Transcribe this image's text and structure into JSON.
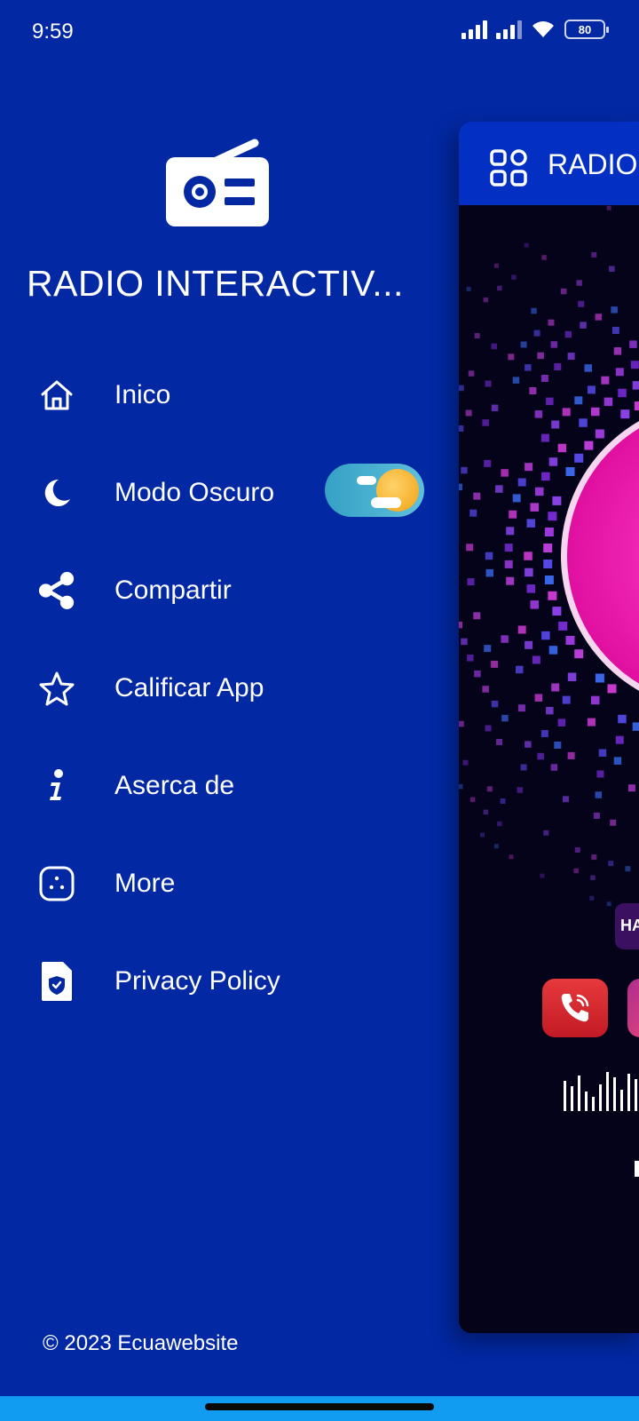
{
  "status_bar": {
    "time": "9:59",
    "battery": "80"
  },
  "drawer": {
    "title": "RADIO INTERACTIV...",
    "menu": [
      {
        "label": "Inico",
        "icon": "home-icon"
      },
      {
        "label": "Modo Oscuro",
        "icon": "moon-icon"
      },
      {
        "label": "Compartir",
        "icon": "share-icon"
      },
      {
        "label": "Calificar App",
        "icon": "star-icon"
      },
      {
        "label": "Aserca de",
        "icon": "info-icon"
      },
      {
        "label": "More",
        "icon": "more-apps-icon"
      },
      {
        "label": "Privacy Policy",
        "icon": "shield-document-icon"
      }
    ],
    "footer": "© 2023 Ecuawebsite"
  },
  "main_peek": {
    "title": "RADIO",
    "partial_badge": "HA"
  },
  "colors": {
    "background": "#0228a3",
    "app_bar": "#0330c2",
    "accent_pink": "#ff1fb8",
    "nav_strip": "#129cf1"
  }
}
